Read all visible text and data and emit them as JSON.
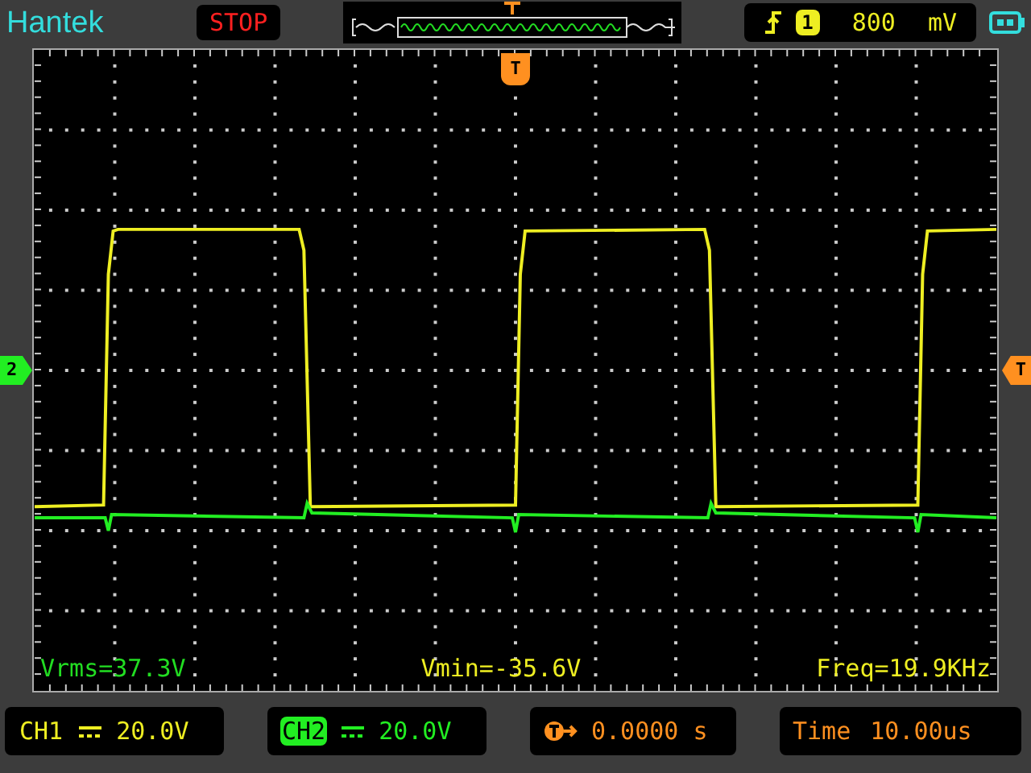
{
  "brand": "Hantek",
  "run_state": "STOP",
  "trigger": {
    "source": "1",
    "level": "800",
    "unit": "mV"
  },
  "markers": {
    "trigger_position": "T",
    "ch2_ground": "2",
    "trigger_level": "T"
  },
  "measurements": [
    {
      "text": "Vrms=37.3V",
      "color": "#22dd22"
    },
    {
      "text": "Vmin=-35.6V",
      "color": "#eeee22"
    },
    {
      "text": "Freq=19.9KHz",
      "color": "#eeee22"
    }
  ],
  "channels": [
    {
      "label": "CH1",
      "scale": "20.0V",
      "color": "#eeee22",
      "selected": false
    },
    {
      "label": "CH2",
      "scale": "20.0V",
      "color": "#22ee22",
      "selected": true
    }
  ],
  "trigger_offset": "0.0000 s",
  "timebase": {
    "label": "Time",
    "value": "10.00us"
  }
}
